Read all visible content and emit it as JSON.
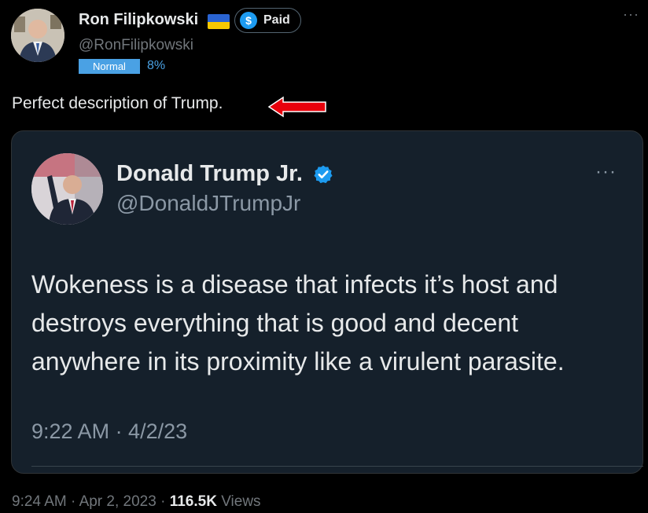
{
  "author": {
    "name": "Ron Filipkowski",
    "flag_icon": "ukraine-flag-icon",
    "paid_badge": "Paid",
    "dollar_symbol": "$",
    "handle": "@RonFilipkowski",
    "status_badge": "Normal",
    "percent": "8%",
    "more": "···"
  },
  "post": {
    "text": "Perfect description of Trump."
  },
  "quoted": {
    "name": "Donald Trump Jr.",
    "handle": "@DonaldJTrumpJr",
    "more": "···",
    "text": "Wokeness is a disease that infects it’s host and destroys everything that is good and decent anywhere in its proximity like a virulent parasite.",
    "timestamp": "9:22 AM · 4/2/23"
  },
  "footer": {
    "time": "9:24 AM",
    "sep1": " · ",
    "date": "Apr 2, 2023",
    "sep2": " · ",
    "views_count": "116.5K",
    "views_label": " Views"
  },
  "colors": {
    "background": "#000000",
    "card": "#15202b",
    "accent_blue": "#1d9bf0",
    "arrow_red": "#e8000b",
    "badge_blue": "#4aa1e4"
  }
}
